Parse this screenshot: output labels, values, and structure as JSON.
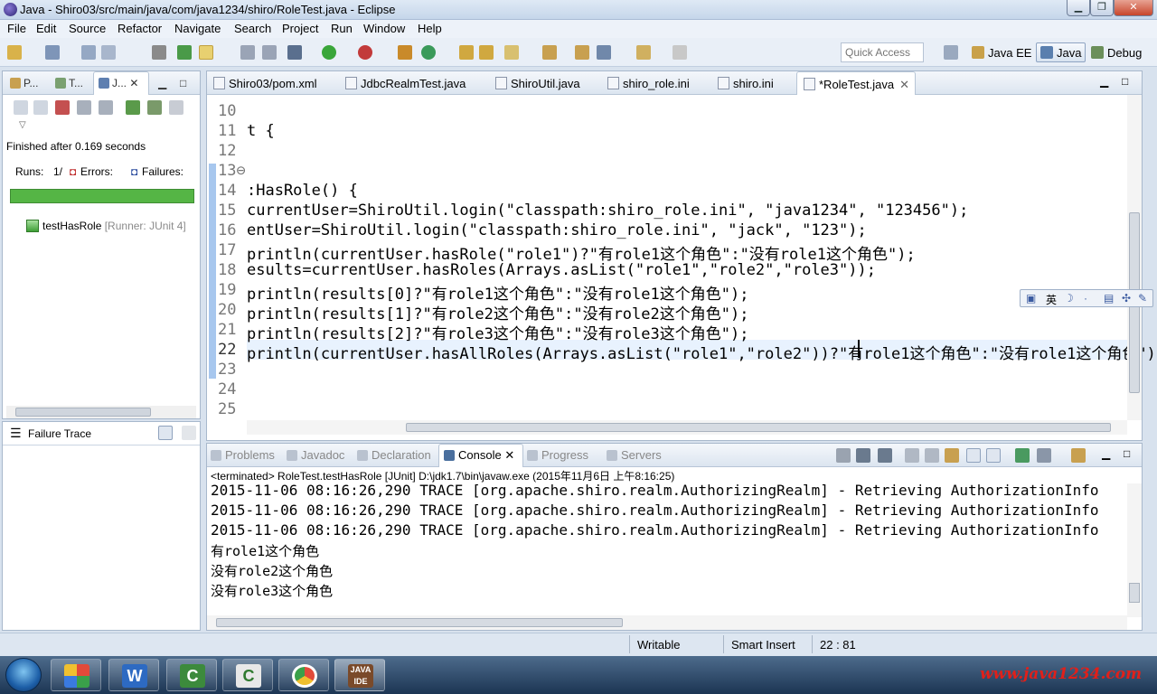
{
  "window": {
    "title": "Java - Shiro03/src/main/java/com/java1234/shiro/RoleTest.java - Eclipse"
  },
  "menu": [
    "File",
    "Edit",
    "Source",
    "Refactor",
    "Navigate",
    "Search",
    "Project",
    "Run",
    "Window",
    "Help"
  ],
  "toolbar": {
    "quick_access_placeholder": "Quick Access",
    "perspectives": [
      "Java EE",
      "Java",
      "Debug"
    ]
  },
  "junit": {
    "tabs": [
      "P...",
      "T...",
      "J..."
    ],
    "finished": "Finished after 0.169 seconds",
    "runs_label": "Runs:",
    "runs_value": "1/",
    "errors_label": "Errors:",
    "failures_label": "Failures:",
    "progress_status": "passed",
    "test_name": "testHasRole",
    "test_runner": "[Runner: JUnit 4]",
    "failure_trace_label": "Failure Trace"
  },
  "editor": {
    "tabs": [
      {
        "label": "Shiro03/pom.xml"
      },
      {
        "label": "JdbcRealmTest.java"
      },
      {
        "label": "ShiroUtil.java"
      },
      {
        "label": "shiro_role.ini"
      },
      {
        "label": "shiro.ini"
      },
      {
        "label": "*RoleTest.java",
        "close": "✕"
      }
    ],
    "lines": [
      {
        "n": "10",
        "code": ""
      },
      {
        "n": "11",
        "code": "t {"
      },
      {
        "n": "12",
        "code": ""
      },
      {
        "n": "13⊖",
        "code": ""
      },
      {
        "n": "14",
        "code": ":HasRole() {"
      },
      {
        "n": "15",
        "code": "currentUser=ShiroUtil.login(\"classpath:shiro_role.ini\", \"java1234\", \"123456\");"
      },
      {
        "n": "16",
        "code": "entUser=ShiroUtil.login(\"classpath:shiro_role.ini\", \"jack\", \"123\");"
      },
      {
        "n": "17",
        "code": "println(currentUser.hasRole(\"role1\")?\"有role1这个角色\":\"没有role1这个角色\");"
      },
      {
        "n": "18",
        "code": "esults=currentUser.hasRoles(Arrays.asList(\"role1\",\"role2\",\"role3\"));"
      },
      {
        "n": "19",
        "code": "println(results[0]?\"有role1这个角色\":\"没有role1这个角色\");"
      },
      {
        "n": "20",
        "code": "println(results[1]?\"有role2这个角色\":\"没有role2这个角色\");"
      },
      {
        "n": "21",
        "code": "println(results[2]?\"有role3这个角色\":\"没有role3这个角色\");"
      },
      {
        "n": "22",
        "code": "println(currentUser.hasAllRoles(Arrays.asList(\"role1\",\"role2\"))?\"有role1这个角色\":\"没有role1这个角色\");"
      },
      {
        "n": "23",
        "code": ""
      },
      {
        "n": "24",
        "code": ""
      },
      {
        "n": "25",
        "code": ""
      }
    ]
  },
  "ime": {
    "label": "英"
  },
  "console": {
    "tabs": [
      "Problems",
      "Javadoc",
      "Declaration",
      "Console",
      "Progress",
      "Servers"
    ],
    "active_tab": "Console",
    "terminated": "<terminated> RoleTest.testHasRole [JUnit] D:\\jdk1.7\\bin\\javaw.exe (2015年11月6日 上午8:16:25)",
    "lines": [
      "2015-11-06 08:16:26,290 TRACE [org.apache.shiro.realm.AuthorizingRealm] - Retrieving AuthorizationInfo",
      "2015-11-06 08:16:26,290 TRACE [org.apache.shiro.realm.AuthorizingRealm] - Retrieving AuthorizationInfo",
      "2015-11-06 08:16:26,290 TRACE [org.apache.shiro.realm.AuthorizingRealm] - Retrieving AuthorizationInfo",
      "有role1这个角色",
      "没有role2这个角色",
      "没有role3这个角色"
    ]
  },
  "status": {
    "writable": "Writable",
    "insert_mode": "Smart Insert",
    "position": "22 : 81"
  },
  "watermark": "www.java1234.com"
}
